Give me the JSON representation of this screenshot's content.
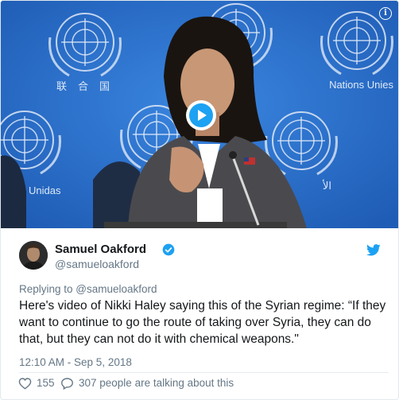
{
  "video": {
    "seal_labels": {
      "chinese": "联合国",
      "english": "Nations Unies",
      "spanish": "Unidas",
      "arabic": "الأ"
    },
    "info_icon": "i",
    "play_icon": "play-icon"
  },
  "tweet": {
    "author": {
      "display_name": "Samuel Oakford",
      "handle": "@samueloakford",
      "verified": true
    },
    "reply_prefix": "Replying to ",
    "reply_to": "@samueloakford",
    "text": "Here's video of Nikki Haley saying this of the Syrian regime: “If they want to continue to go  the route of taking over Syria, they can do that, but they can not do it  with chemical weapons.\"",
    "timestamp": "12:10 AM - Sep 5, 2018",
    "likes": "155",
    "talking": "307 people are talking about this"
  },
  "colors": {
    "twitter_blue": "#1da1f2",
    "background_blue": "#2a6fc9",
    "text_dark": "#14171a",
    "text_gray": "#657786"
  }
}
